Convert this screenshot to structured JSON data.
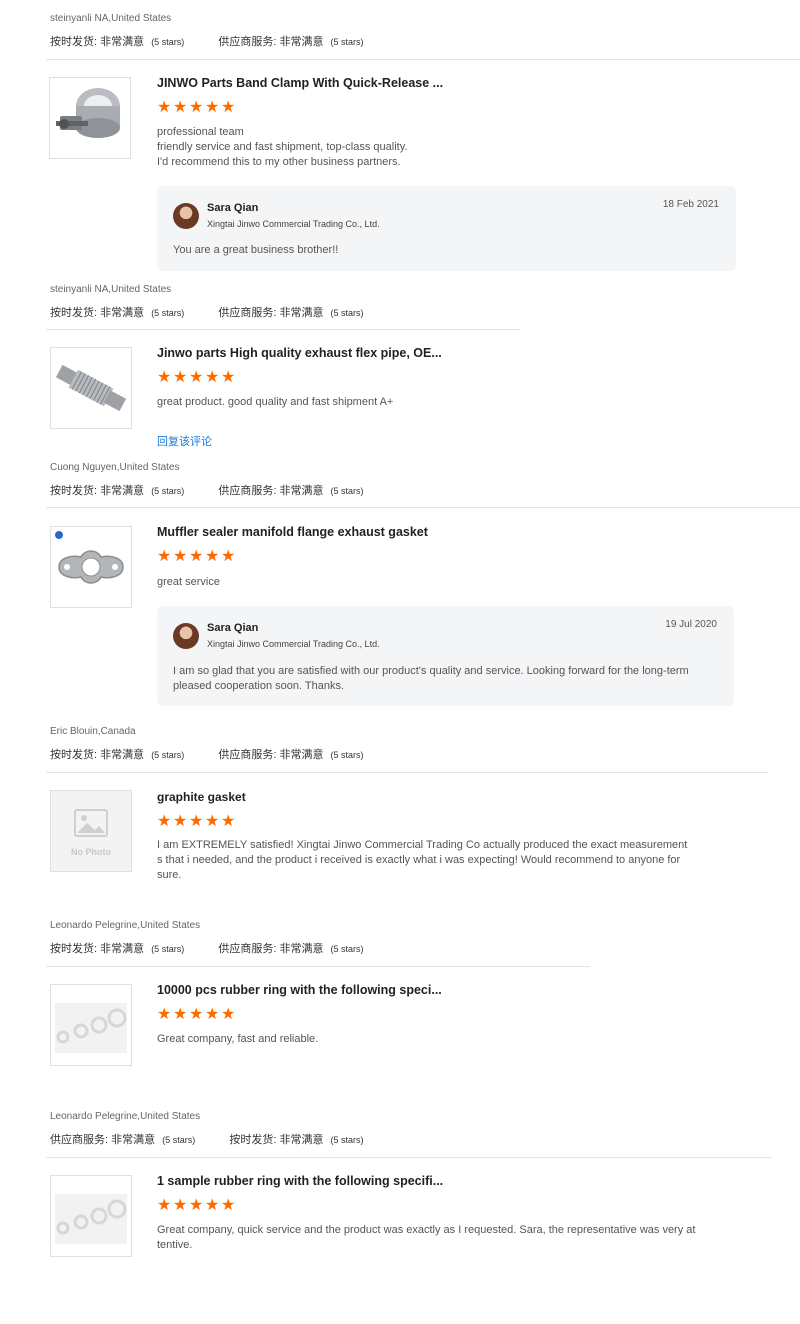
{
  "rating_labels": {
    "on_time": "按时发货:",
    "supplier_service": "供应商服务:",
    "very_satisfied": "非常满意",
    "stars_text": "(5 stars)"
  },
  "reviews": [
    {
      "user": "steinyanli NA,United States",
      "product_title": "JINWO Parts Band Clamp With Quick-Release ...",
      "product_icon": "band-clamp-image",
      "rating": 5,
      "text_lines": [
        "professional team",
        "friendly service and fast shipment, top-class quality.",
        "I'd recommend this to my other business partners."
      ],
      "reply": {
        "name": "Sara Qian",
        "company": "Xingtai Jinwo Commercial Trading Co., Ltd.",
        "date": "18 Feb 2021",
        "text": "You are a great business brother!!"
      }
    },
    {
      "user": "steinyanli NA,United States",
      "product_title": "Jinwo parts High quality exhaust flex pipe, OE...",
      "product_icon": "flex-pipe-image",
      "rating": 5,
      "text_lines": [
        "great product. good quality and fast shipment A+"
      ],
      "reply_link": "回复该评论"
    },
    {
      "user": "Cuong Nguyen,United States",
      "product_title": "Muffler sealer manifold flange exhaust gasket",
      "product_icon": "gasket-image",
      "rating": 5,
      "text_lines": [
        "great service"
      ],
      "reply": {
        "name": "Sara Qian",
        "company": "Xingtai Jinwo Commercial Trading Co., Ltd.",
        "date": "19 Jul 2020",
        "text_lines": [
          "I am so glad that you are satisfied with our product's quality and service. Looking forward for the long-term",
          "pleased cooperation soon. Thanks."
        ]
      }
    },
    {
      "user": "Eric Blouin,Canada",
      "product_title": "graphite gasket",
      "product_icon": "no-photo-image",
      "no_photo_text": "No Photo",
      "rating": 5,
      "text_lines": [
        "I am EXTREMELY satisfied! Xingtai Jinwo Commercial Trading Co actually produced the exact measurement",
        "s that i needed, and the product i received is exactly what i was expecting! Would recommend to anyone for",
        "sure."
      ]
    },
    {
      "user": "Leonardo Pelegrine,United States",
      "product_title": "10000 pcs rubber ring with the following speci...",
      "product_icon": "rubber-ring-image",
      "rating": 5,
      "text_lines": [
        "Great company, fast and reliable."
      ]
    },
    {
      "user": "Leonardo Pelegrine,United States",
      "product_title": "1 sample rubber ring with the following specifi...",
      "product_icon": "rubber-ring-image",
      "rating": 5,
      "text_lines": [
        "Great company, quick service and the product was exactly as I requested. Sara, the representative was very at",
        "tentive."
      ]
    }
  ],
  "colors": {
    "star": "#ff6a00",
    "link": "#1a7bd6",
    "reply_bg": "#f4f5f7"
  }
}
